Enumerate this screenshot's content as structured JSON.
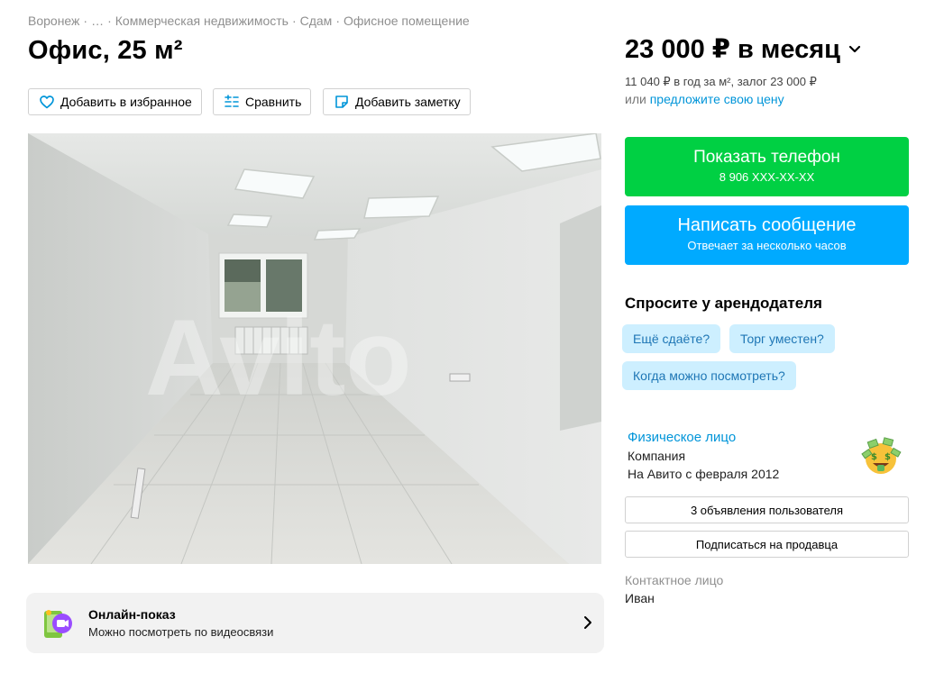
{
  "breadcrumb": [
    "Воронеж",
    "…",
    "Коммерческая недвижимость",
    "Сдам",
    "Офисное помещение"
  ],
  "title": "Офис, 25 м²",
  "actions": {
    "favorite": "Добавить в избранное",
    "compare": "Сравнить",
    "note": "Добавить заметку"
  },
  "photo": {
    "watermark": "Avito"
  },
  "online_show": {
    "title": "Онлайн-показ",
    "subtitle": "Можно посмотреть по видеосвязи"
  },
  "price": {
    "main": "23 000 ₽ в месяц",
    "detail": "11 040 ₽ в год за м², залог 23 000 ₽",
    "offer_prefix": "или",
    "offer_link": "предложите свою цену"
  },
  "buttons": {
    "phone_label": "Показать телефон",
    "phone_number": "8 906 XXX-XX-XX",
    "message_label": "Написать сообщение",
    "message_sub": "Отвечает за несколько часов"
  },
  "ask": {
    "title": "Спросите у арендодателя",
    "chips": [
      "Ещё сдаёте?",
      "Торг уместен?",
      "Когда можно посмотреть?"
    ]
  },
  "seller": {
    "name": "Физическое лицо",
    "type": "Компания",
    "since": "На Авито с февраля 2012",
    "listings_button": "3 объявления пользователя",
    "subscribe_button": "Подписаться на продавца"
  },
  "contact": {
    "label": "Контактное лицо",
    "name": "Иван"
  },
  "colors": {
    "green": "#00d043",
    "blue": "#00aaff",
    "link": "#0095d9",
    "chip_bg": "#cdefff"
  },
  "icons": {
    "favorite": "heart-icon",
    "compare": "compare-list-icon",
    "note": "note-icon",
    "online": "video-call-icon",
    "price_toggle": "chevron-down-icon"
  }
}
